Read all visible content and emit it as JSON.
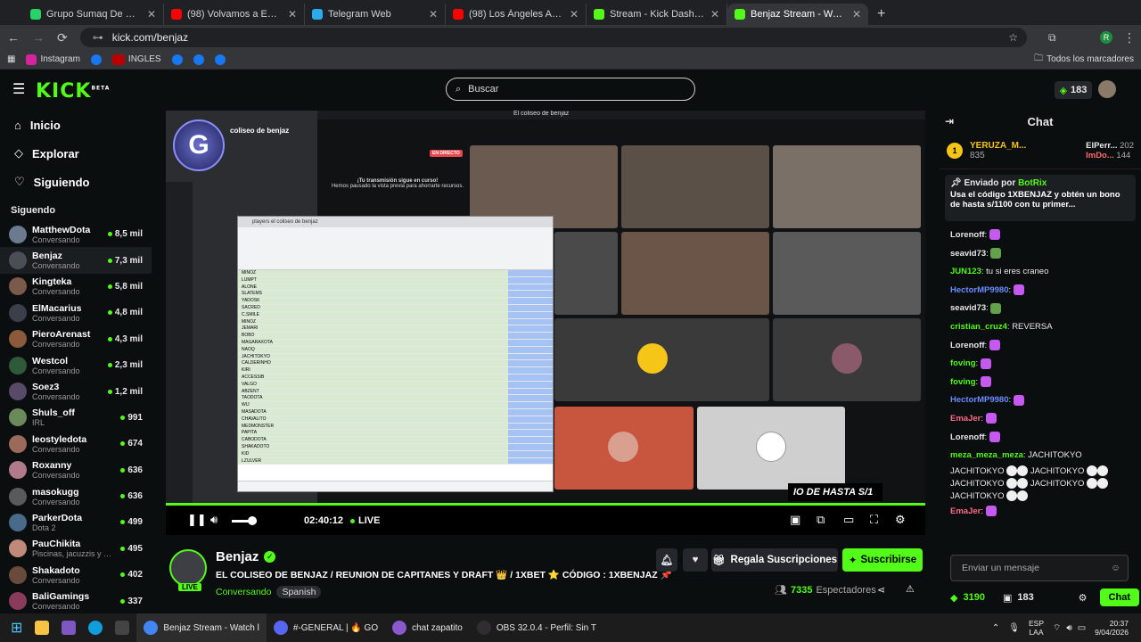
{
  "browser": {
    "tabs": [
      {
        "title": "Grupo Sumaq De Crispin Alegr",
        "color": "#25d366",
        "active": false
      },
      {
        "title": "(98) Volvamos a Empezar - You",
        "color": "#ff0000",
        "active": false
      },
      {
        "title": "Telegram Web",
        "color": "#2aabee",
        "active": false
      },
      {
        "title": "(98) Los Ángeles Azules - Nunc",
        "color": "#ff0000",
        "active": false
      },
      {
        "title": "Stream - Kick Dashboard",
        "color": "#53fc18",
        "active": false
      },
      {
        "title": "Benjaz Stream - Watch Live",
        "color": "#53fc18",
        "active": true
      }
    ],
    "url": "kick.com/benjaz",
    "bookmarks": [
      "Instagram",
      "INGLES"
    ],
    "all_bookmarks": "Todos los marcadores",
    "profile_initial": "R"
  },
  "header": {
    "logo": "KICK",
    "logo_sup": "BETA",
    "search_placeholder": "Buscar",
    "kicks_balance": "183"
  },
  "sidebar": {
    "nav": [
      {
        "label": "Inicio",
        "icon": "home-icon"
      },
      {
        "label": "Explorar",
        "icon": "compass-icon"
      },
      {
        "label": "Siguiendo",
        "icon": "heart-icon"
      }
    ],
    "following_title": "Siguendo",
    "channels": [
      {
        "name": "MatthewDota",
        "category": "Conversando",
        "viewers": "8,5 mil",
        "color": "#6b7a8f"
      },
      {
        "name": "Benjaz",
        "category": "Conversando",
        "viewers": "7,3 mil",
        "color": "#4a4f57"
      },
      {
        "name": "Kingteka",
        "category": "Conversando",
        "viewers": "5,8 mil",
        "color": "#7a5a4a"
      },
      {
        "name": "ElMacarius",
        "category": "Conversando",
        "viewers": "4,8 mil",
        "color": "#3a3f4a"
      },
      {
        "name": "PieroArenast",
        "category": "Conversando",
        "viewers": "4,3 mil",
        "color": "#8a5a3a"
      },
      {
        "name": "Westcol",
        "category": "Conversando",
        "viewers": "2,3 mil",
        "color": "#2f5a3a"
      },
      {
        "name": "Soez3",
        "category": "Conversando",
        "viewers": "1,2 mil",
        "color": "#5a4a6a"
      },
      {
        "name": "Shuls_off",
        "category": "IRL",
        "viewers": "991",
        "color": "#6a8a5a"
      },
      {
        "name": "leostyledota",
        "category": "Conversando",
        "viewers": "674",
        "color": "#9a6a5a"
      },
      {
        "name": "Roxanny",
        "category": "Conversando",
        "viewers": "636",
        "color": "#b07a8a"
      },
      {
        "name": "masokugg",
        "category": "Conversando",
        "viewers": "636",
        "color": "#5a5a5a"
      },
      {
        "name": "ParkerDota",
        "category": "Dota 2",
        "viewers": "499",
        "color": "#4a6a8a"
      },
      {
        "name": "PauChikita",
        "category": "Piscinas, jacuzzis y bi...",
        "viewers": "495",
        "color": "#c08a7a"
      },
      {
        "name": "Shakadoto",
        "category": "Conversando",
        "viewers": "402",
        "color": "#6a4a3a"
      },
      {
        "name": "BaliGamings",
        "category": "Conversando",
        "viewers": "337",
        "color": "#8a3a5a"
      }
    ]
  },
  "player": {
    "time": "02:40:12",
    "live_label": "LIVE",
    "overlay_banner": "IO DE HASTA S/1",
    "scene_title": "El coliseo de benjaz",
    "discord_server": "coliseo de benjaz",
    "transmission_notice_title": "¡Tu transmisión sigue en curso!",
    "transmission_notice_body": "Hemos pausado la vista previa para ahorrarte recursos.",
    "en_directo": "EN DIRECTO",
    "sheet_title": "players el coliseo de benjaz",
    "sheet_rows": [
      "MINOZ",
      "LUMPT",
      "ALONE",
      "SLATEMS",
      "YADOSK",
      "SACRED",
      "C.SMILE",
      "MINOZ",
      "JEMARI",
      "BOBO",
      "MAGARAXOTA",
      "NAOQ",
      "JACHITOKYO",
      "CALDERINHO",
      "KIRI",
      "ACCESSIB",
      "VALGO",
      "ABZENT",
      "TAODOTA",
      "WIJ",
      "MASADOTA",
      "CHAVALITO",
      "MEDMONSTER",
      "PAPITA",
      "CABODOTA",
      "SHAKADOTO",
      "KID",
      "LZULVER"
    ]
  },
  "stream": {
    "streamer": "Benjaz",
    "live_badge": "LIVE",
    "title": "EL COLISEO DE BENJAZ / REUNION DE CAPITANES Y DRAFT 👑 / 1XBET ⭐ CÓDIGO : 1XBENJAZ 📌",
    "category": "Conversando",
    "language": "Spanish",
    "gift_button": "Regala Suscripciones",
    "subscribe_button": "Suscribirse",
    "viewers": "7335",
    "viewers_label": "Espectadores"
  },
  "chat": {
    "title": "Chat",
    "leaderboard": [
      {
        "rank": "1",
        "name": "YERUZA_M...",
        "points": "835"
      },
      {
        "name": "ElPerr...",
        "points": "202"
      },
      {
        "name": "ImDo...",
        "points": "144"
      }
    ],
    "pinned_by_label": "Enviado por",
    "pinned_by": "BotRix",
    "pinned_text": "Usa el código 1XBENJAZ y obtén un bono de hasta s/1100 con tu primer...",
    "messages": [
      {
        "user": "Lorenoff",
        "color": "#e8e8e8",
        "text": ""
      },
      {
        "user": "seavid73",
        "color": "#e8e8e8",
        "text": ""
      },
      {
        "user": "JUN123",
        "color": "#53fc18",
        "text": "tu si eres craneo"
      },
      {
        "user": "HectorMP9980",
        "color": "#6b8cff",
        "text": ""
      },
      {
        "user": "seavid73",
        "color": "#e8e8e8",
        "text": ""
      },
      {
        "user": "cristian_cruz4",
        "color": "#53fc18",
        "text": "REVERSA"
      },
      {
        "user": "Lorenoff",
        "color": "#e8e8e8",
        "text": ""
      },
      {
        "user": "foving",
        "color": "#53fc18",
        "text": ""
      },
      {
        "user": "foving",
        "color": "#53fc18",
        "text": ""
      },
      {
        "user": "HectorMP9980",
        "color": "#6b8cff",
        "text": ""
      },
      {
        "user": "EmaJer",
        "color": "#ff6b8a",
        "text": ""
      },
      {
        "user": "Lorenoff",
        "color": "#e8e8e8",
        "text": ""
      },
      {
        "user": "meza_meza_meza",
        "color": "#53fc18",
        "text": "JACHITOKYO"
      }
    ],
    "spam_lines": [
      "JACHITOKYO",
      "JACHITOKYO",
      "JACHITOKYO",
      "JACHITOKYO",
      "JACHITOKYO"
    ],
    "last_user": "EmaJer",
    "input_placeholder": "Enviar un mensaje",
    "points": "3190",
    "kicks": "183",
    "send_button": "Chat"
  },
  "taskbar": {
    "apps": [
      {
        "label": "Benjaz Stream - Watch l",
        "color": "#4285f4"
      },
      {
        "label": "#-GENERAL | 🔥 GO",
        "color": "#5865f2"
      },
      {
        "label": "chat zapatito",
        "color": "#8a5acd"
      },
      {
        "label": "OBS 32.0.4 - Perfil: Sin T",
        "color": "#302e31"
      }
    ],
    "lang": "ESP",
    "lang2": "LAA",
    "time": "20:37",
    "date": "9/04/2026"
  }
}
